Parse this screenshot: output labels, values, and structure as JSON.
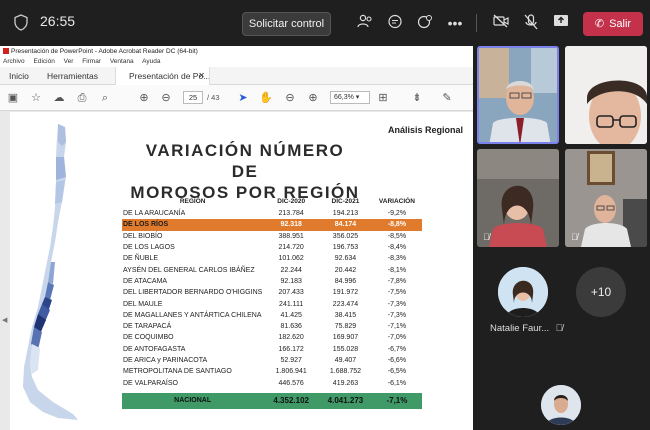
{
  "topbar": {
    "timer": "26:55",
    "request_control": "Solicitar control",
    "leave": "Salir"
  },
  "acrobat": {
    "title": "Presentación de PowerPoint - Adobe Acrobat Reader DC (64-bit)",
    "menu": [
      "Archivo",
      "Edición",
      "Ver",
      "Firmar",
      "Ventana",
      "Ayuda"
    ],
    "tabs": {
      "home": "Inicio",
      "tools": "Herramientas",
      "document": "Presentación de Po..."
    },
    "page_current": "25",
    "page_total": "/ 43",
    "zoom": "66,3%"
  },
  "slide": {
    "section_title": "Análisis Regional",
    "title_line1": "VARIACIÓN NÚMERO DE",
    "title_line2": "MOROSOS POR REGIÓN",
    "columns": [
      "REGIÓN",
      "DIC-2020",
      "DIC-2021",
      "VARIACIÓN"
    ],
    "rows": [
      [
        "DE LA ARAUCANÍA",
        "213.784",
        "194.213",
        "-9,2%"
      ],
      [
        "DE LOS RÍOS",
        "92.318",
        "84.174",
        "-8,8%"
      ],
      [
        "DEL BIOBÍO",
        "388.951",
        "356.025",
        "-8,5%"
      ],
      [
        "DE LOS LAGOS",
        "214.720",
        "196.753",
        "-8,4%"
      ],
      [
        "DE ÑUBLE",
        "101.062",
        "92.634",
        "-8,3%"
      ],
      [
        "AYSÉN DEL GENERAL CARLOS IBÁÑEZ",
        "22.244",
        "20.442",
        "-8,1%"
      ],
      [
        "DE ATACAMA",
        "92.183",
        "84.996",
        "-7,8%"
      ],
      [
        "DEL LIBERTADOR BERNARDO O'HIGGINS",
        "207.433",
        "191.972",
        "-7,5%"
      ],
      [
        "DEL MAULE",
        "241.111",
        "223.474",
        "-7,3%"
      ],
      [
        "DE MAGALLANES Y ANTÁRTICA CHILENA",
        "41.425",
        "38.415",
        "-7,3%"
      ],
      [
        "DE TARAPACÁ",
        "81.636",
        "75.829",
        "-7,1%"
      ],
      [
        "DE COQUIMBO",
        "182.620",
        "169.907",
        "-7,0%"
      ],
      [
        "DE ANTOFAGASTA",
        "166.172",
        "155.028",
        "-6,7%"
      ],
      [
        "DE ARICA y PARINACOTA",
        "52.927",
        "49.407",
        "-6,6%"
      ],
      [
        "METROPOLITANA DE SANTIAGO",
        "1.806.941",
        "1.688.752",
        "-6,5%"
      ],
      [
        "DE VALPARAÍSO",
        "446.576",
        "419.263",
        "-6,1%"
      ]
    ],
    "total": [
      "NACIONAL",
      "4.352.102",
      "4.041.273",
      "-7,1%"
    ]
  },
  "participants": {
    "name_natalie": "Natalie Faur...",
    "more_count": "+10"
  },
  "colors": {
    "highlight_row": "#e07b2d",
    "total_row": "#3f9a67",
    "leave_button": "#c4314b",
    "speaker_border": "#7b83eb"
  }
}
